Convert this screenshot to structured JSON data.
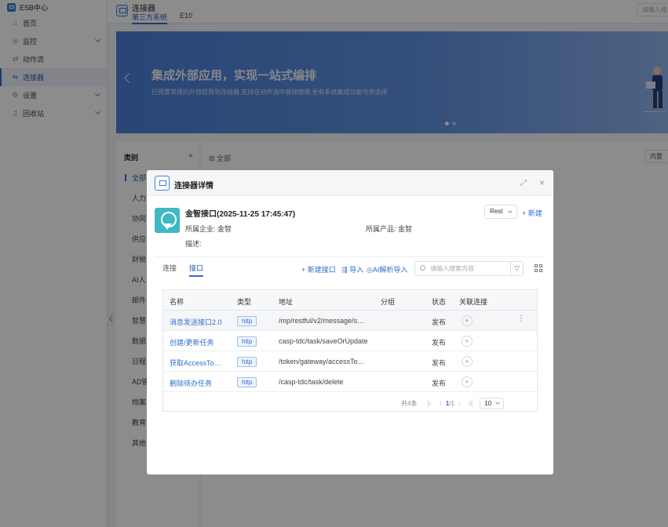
{
  "app": {
    "brand": "ESB中心"
  },
  "sidebar": {
    "items": [
      {
        "label": "首页",
        "icon": "home-icon"
      },
      {
        "label": "监控",
        "icon": "monitor-icon",
        "expandable": true
      },
      {
        "label": "动作流",
        "icon": "flow-icon"
      },
      {
        "label": "连接器",
        "icon": "connector-icon",
        "active": true
      },
      {
        "label": "设置",
        "icon": "gear-icon",
        "expandable": true
      },
      {
        "label": "回收站",
        "icon": "trash-icon",
        "expandable": true
      }
    ]
  },
  "topbar": {
    "title": "连接器",
    "tabs": [
      "第三方系统",
      "E10"
    ],
    "search_placeholder": "请输入搜"
  },
  "banner": {
    "title": "集成外部应用，实现一站式编排",
    "subtitle": "已预置常用的外部应用到连接器,支持在动作流中直接使用,更有系统集成功能可供选择"
  },
  "category": {
    "header": "类别",
    "add": "+",
    "items": [
      "全部",
      "人力",
      "协同",
      "供应",
      "财税",
      "AI人",
      "邮件",
      "智慧",
      "数据",
      "日程",
      "AD管",
      "档案",
      "教育",
      "其他"
    ]
  },
  "main": {
    "all_label": "全部",
    "builtin_label": "内置"
  },
  "modal": {
    "title": "连接器详情",
    "connector_name": "金智接口(2025-11-25 17:45:47)",
    "enterprise": "所属企业: 金智",
    "product": "所属产品: 金智",
    "description": "描述:",
    "protocol": "Rest",
    "new_label": "+ 新建",
    "tabs": [
      "连接",
      "接口"
    ],
    "actions": {
      "new_interface": "+ 新建接口",
      "import": "导入",
      "ai_import": "AI解析导入"
    },
    "search_placeholder": "请输入搜索内容",
    "table": {
      "headers": [
        "名称",
        "类型",
        "地址",
        "分组",
        "状态",
        "关联连接"
      ],
      "rows": [
        {
          "name": "消息发送接口2.0",
          "type": "http",
          "address": "/mp/restful/v2/message/s…",
          "group": "",
          "status": "发布"
        },
        {
          "name": "创建/更新任务",
          "type": "http",
          "address": "casp-tdc/task/saveOrUpdate",
          "group": "",
          "status": "发布"
        },
        {
          "name": "获取AccessTo…",
          "type": "http",
          "address": "/token/gateway/accessTo…",
          "group": "",
          "status": "发布"
        },
        {
          "name": "删除待办任务",
          "type": "http",
          "address": "/casp-tdc/task/delete",
          "group": "",
          "status": "发布"
        }
      ]
    },
    "pager": {
      "total": "共4条",
      "current": "1",
      "pages": "/1",
      "page_size": "10"
    }
  },
  "colors": {
    "accent": "#2f6fd0",
    "banner": "#4a7fd8",
    "logo": "#3fb8c4"
  }
}
